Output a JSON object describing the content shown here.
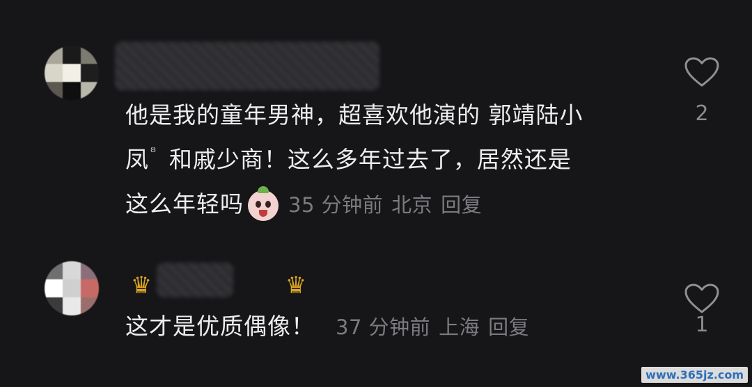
{
  "comments": [
    {
      "text_lines": [
        "他是我的童年男神，超喜欢他演的 郭靖陆小",
        "凤",
        "和戚少商！这么多年过去了，居然还是",
        "这么年轻吗"
      ],
      "search_mark": "ᴽ",
      "emoji": "blushing-face-emoji",
      "time": "35 分钟前",
      "location": "北京",
      "reply_label": "回复",
      "like_count": "2"
    },
    {
      "text": "这才是优质偶像！",
      "time": "37 分钟前",
      "location": "上海",
      "reply_label": "回复",
      "like_count": "1"
    }
  ],
  "watermark": "www.365jz.com",
  "colors": {
    "background": "#161618",
    "text": "#ededee",
    "meta": "#7b7b80",
    "crown": "#d9a321"
  }
}
